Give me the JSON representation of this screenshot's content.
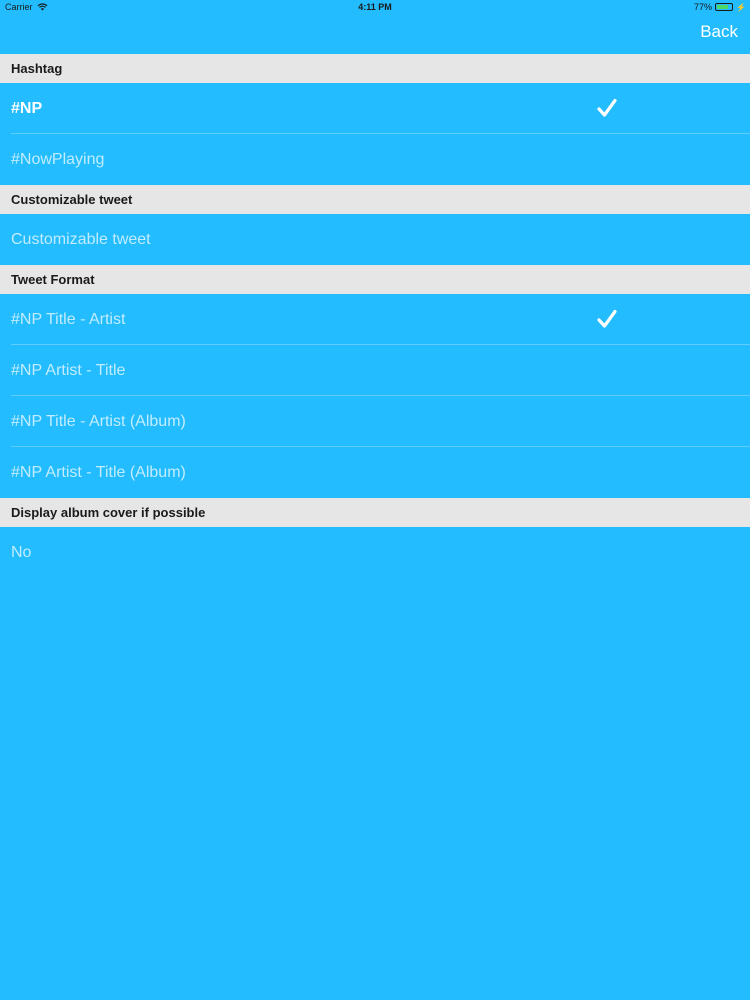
{
  "status_bar": {
    "carrier": "Carrier",
    "time": "4:11 PM",
    "battery_percent": "77%",
    "battery_level": 0.77,
    "battery_color": "#4cd964"
  },
  "nav": {
    "back_label": "Back"
  },
  "sections": {
    "hashtag": {
      "header": "Hashtag",
      "items": [
        {
          "label": "#NP",
          "checked": true
        },
        {
          "label": "#NowPlaying",
          "checked": false
        }
      ]
    },
    "customizable": {
      "header": "Customizable tweet",
      "items": [
        {
          "label": "Customizable tweet",
          "checked": false
        }
      ]
    },
    "format": {
      "header": "Tweet Format",
      "items": [
        {
          "label": "#NP Title - Artist",
          "checked": true
        },
        {
          "label": "#NP Artist - Title",
          "checked": false
        },
        {
          "label": "#NP Title - Artist (Album)",
          "checked": false
        },
        {
          "label": "#NP Artist - Title (Album)",
          "checked": false
        }
      ]
    },
    "album_cover": {
      "header": "Display album cover if possible",
      "items": [
        {
          "label": "No",
          "checked": false
        }
      ]
    }
  },
  "icons": {
    "check": "checkmark-icon",
    "wifi": "wifi-icon",
    "battery": "battery-icon",
    "charge": "charging-bolt-icon"
  },
  "colors": {
    "background": "#22bcff",
    "section_header": "#e6e6e6",
    "accent": "#ffffff"
  }
}
